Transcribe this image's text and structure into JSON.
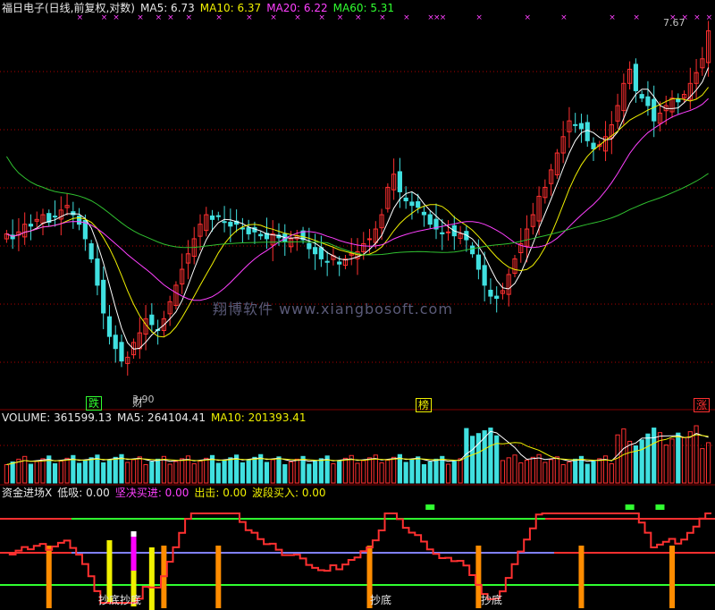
{
  "price_panel": {
    "title": "福日电子(日线,前复权,对数)",
    "ma5": "MA5: 6.73",
    "ma10": "MA10: 6.37",
    "ma20": "MA20: 6.22",
    "ma60": "MA60: 5.31",
    "high_label": "7.67",
    "low_label": "3.90",
    "tag_die": "跌",
    "tag_cai": "财",
    "tag_bang": "榜",
    "tag_zhang": "涨"
  },
  "volume_panel": {
    "volume": "VOLUME: 361599.13",
    "ma5": "MA5: 264104.41",
    "ma10": "MA10: 201393.41"
  },
  "indicator_panel": {
    "name": "资金进场X",
    "dixi": "低吸: 0.00",
    "jianjue": "坚决买进: 0.00",
    "chuji": "出击: 0.00",
    "boduan": "波段买入: 0.00",
    "chaodi_labels": [
      "抄底",
      "抄底",
      "抄底",
      "抄底",
      "抄底"
    ]
  },
  "watermark": "翔博软件 www.xiangbosoft.com",
  "colors": {
    "up": "#ff3030",
    "down": "#40e0e0",
    "ma5": "#ffffff",
    "ma10": "#f0f000",
    "ma20": "#ff40ff",
    "ma60": "#30c030",
    "grid": "#b00000"
  },
  "chart_data": {
    "type": "candlestick",
    "title": "福日电子(日线,前复权,对数)",
    "series_count": 130,
    "close": [
      5.1,
      5.05,
      5.12,
      5.2,
      5.18,
      5.25,
      5.3,
      5.22,
      5.28,
      5.35,
      5.4,
      5.3,
      5.2,
      5.05,
      4.85,
      4.6,
      4.35,
      4.15,
      4.05,
      3.95,
      3.98,
      4.1,
      4.18,
      4.3,
      4.25,
      4.2,
      4.3,
      4.45,
      4.6,
      4.75,
      4.9,
      5.05,
      5.2,
      5.3,
      5.25,
      5.28,
      5.22,
      5.18,
      5.2,
      5.15,
      5.1,
      5.12,
      5.08,
      5.05,
      5.1,
      5.06,
      5.02,
      5.05,
      5.08,
      5.04,
      4.95,
      4.9,
      4.85,
      4.82,
      4.88,
      4.8,
      4.85,
      4.9,
      4.92,
      5.0,
      5.05,
      5.15,
      5.3,
      5.6,
      5.75,
      5.55,
      5.45,
      5.4,
      5.38,
      5.3,
      5.2,
      5.15,
      5.1,
      5.12,
      5.08,
      5.1,
      5.04,
      4.9,
      4.75,
      4.6,
      4.5,
      4.48,
      4.55,
      4.7,
      4.85,
      5.0,
      5.15,
      5.3,
      5.5,
      5.6,
      5.8,
      6.0,
      6.2,
      6.4,
      6.35,
      6.3,
      6.15,
      6.05,
      6.1,
      6.2,
      6.35,
      6.6,
      6.9,
      7.1,
      6.8,
      6.7,
      6.6,
      6.4,
      6.5,
      6.6,
      6.7,
      6.65,
      6.75,
      6.9,
      7.05,
      7.25,
      7.67
    ],
    "volume_ma5": 264104.41,
    "volume_ma10": 201393.41,
    "indicator": {
      "低吸": 0.0,
      "坚决买进": 0.0,
      "出击": 0.0,
      "波段买入": 0.0
    },
    "annotations": [
      "7.67",
      "3.90",
      "跌",
      "财",
      "榜",
      "涨",
      "抄底"
    ]
  }
}
